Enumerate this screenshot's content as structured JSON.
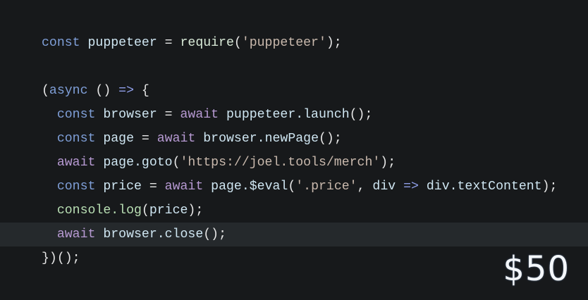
{
  "code": {
    "highlighted_line": 8,
    "lines": [
      [
        [
          "const",
          "kw"
        ],
        [
          " ",
          "pn"
        ],
        [
          "puppeteer",
          "id"
        ],
        [
          " = ",
          "pn"
        ],
        [
          "require",
          "fn"
        ],
        [
          "(",
          "pn"
        ],
        [
          "'puppeteer'",
          "str"
        ],
        [
          ");",
          "pn"
        ]
      ],
      [],
      [
        [
          "(",
          "pn"
        ],
        [
          "async",
          "kw"
        ],
        [
          " () ",
          "pn"
        ],
        [
          "=>",
          "op"
        ],
        [
          " {",
          "pn"
        ]
      ],
      [
        [
          "  ",
          "pn"
        ],
        [
          "const",
          "kw"
        ],
        [
          " ",
          "pn"
        ],
        [
          "browser",
          "id"
        ],
        [
          " = ",
          "pn"
        ],
        [
          "await",
          "aw"
        ],
        [
          " ",
          "pn"
        ],
        [
          "puppeteer.launch",
          "id"
        ],
        [
          "();",
          "pn"
        ]
      ],
      [
        [
          "  ",
          "pn"
        ],
        [
          "const",
          "kw"
        ],
        [
          " ",
          "pn"
        ],
        [
          "page",
          "id"
        ],
        [
          " = ",
          "pn"
        ],
        [
          "await",
          "aw"
        ],
        [
          " ",
          "pn"
        ],
        [
          "browser.newPage",
          "id"
        ],
        [
          "();",
          "pn"
        ]
      ],
      [
        [
          "  ",
          "pn"
        ],
        [
          "await",
          "aw"
        ],
        [
          " ",
          "pn"
        ],
        [
          "page.goto",
          "id"
        ],
        [
          "(",
          "pn"
        ],
        [
          "'https://joel.tools/merch'",
          "str"
        ],
        [
          ");",
          "pn"
        ]
      ],
      [
        [
          "  ",
          "pn"
        ],
        [
          "const",
          "kw"
        ],
        [
          " ",
          "pn"
        ],
        [
          "price",
          "id"
        ],
        [
          " = ",
          "pn"
        ],
        [
          "await",
          "aw"
        ],
        [
          " ",
          "pn"
        ],
        [
          "page.$eval",
          "id"
        ],
        [
          "(",
          "pn"
        ],
        [
          "'.price'",
          "str"
        ],
        [
          ", ",
          "pn"
        ],
        [
          "div",
          "id"
        ],
        [
          " ",
          "pn"
        ],
        [
          "=>",
          "op"
        ],
        [
          " ",
          "pn"
        ],
        [
          "div.textContent",
          "id"
        ],
        [
          ");",
          "pn"
        ]
      ],
      [
        [
          "  ",
          "pn"
        ],
        [
          "console.log",
          "cs"
        ],
        [
          "(",
          "pn"
        ],
        [
          "price",
          "id"
        ],
        [
          ");",
          "pn"
        ]
      ],
      [
        [
          "  ",
          "pn"
        ],
        [
          "await",
          "aw"
        ],
        [
          " ",
          "pn"
        ],
        [
          "browser.close",
          "id"
        ],
        [
          "();",
          "pn"
        ]
      ],
      [
        [
          "})();",
          "pn"
        ]
      ]
    ]
  },
  "output": {
    "price": "$50"
  }
}
